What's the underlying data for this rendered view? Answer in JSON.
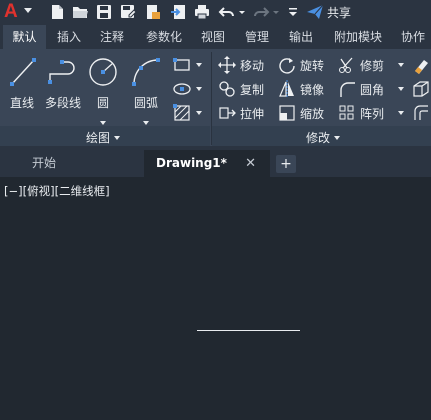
{
  "app": {
    "logo_letter": "A"
  },
  "quick_access": {
    "icons": [
      "new-icon",
      "open-icon",
      "save-icon",
      "save-as-icon",
      "publish-icon",
      "import-icon",
      "print-icon",
      "undo-icon",
      "redo-icon",
      "customize-icon"
    ],
    "share_label": "共享"
  },
  "ribbon_tabs": [
    {
      "label": "默认",
      "active": true
    },
    {
      "label": "插入"
    },
    {
      "label": "注释"
    },
    {
      "label": "参数化"
    },
    {
      "label": "视图"
    },
    {
      "label": "管理"
    },
    {
      "label": "输出"
    },
    {
      "label": "附加模块"
    },
    {
      "label": "协作"
    }
  ],
  "draw_panel": {
    "title": "绘图",
    "tools": [
      {
        "label": "直线",
        "icon": "line-icon"
      },
      {
        "label": "多段线",
        "icon": "polyline-icon"
      },
      {
        "label": "圆",
        "icon": "circle-icon"
      },
      {
        "label": "圆弧",
        "icon": "arc-icon"
      }
    ],
    "small_tools": [
      "rectangle-icon",
      "ellipse-icon",
      "hatch-icon"
    ]
  },
  "modify_panel": {
    "title": "修改",
    "rows": [
      [
        {
          "label": "移动",
          "icon": "move-icon"
        },
        {
          "label": "旋转",
          "icon": "rotate-icon"
        },
        {
          "label": "修剪",
          "icon": "trim-icon"
        }
      ],
      [
        {
          "label": "复制",
          "icon": "copy-icon"
        },
        {
          "label": "镜像",
          "icon": "mirror-icon"
        },
        {
          "label": "圆角",
          "icon": "fillet-icon"
        }
      ],
      [
        {
          "label": "拉伸",
          "icon": "stretch-icon"
        },
        {
          "label": "缩放",
          "icon": "scale-icon"
        },
        {
          "label": "阵列",
          "icon": "array-icon"
        }
      ]
    ]
  },
  "document_tabs": [
    {
      "label": "开始"
    },
    {
      "label": "Drawing1*",
      "active": true
    }
  ],
  "viewport": {
    "label": "[−][俯视][二维线框]"
  },
  "colors": {
    "accent_blue": "#4a90e2",
    "logo_red": "#e0322e",
    "ribbon_bg": "#3a4657",
    "canvas_bg": "#212830"
  }
}
